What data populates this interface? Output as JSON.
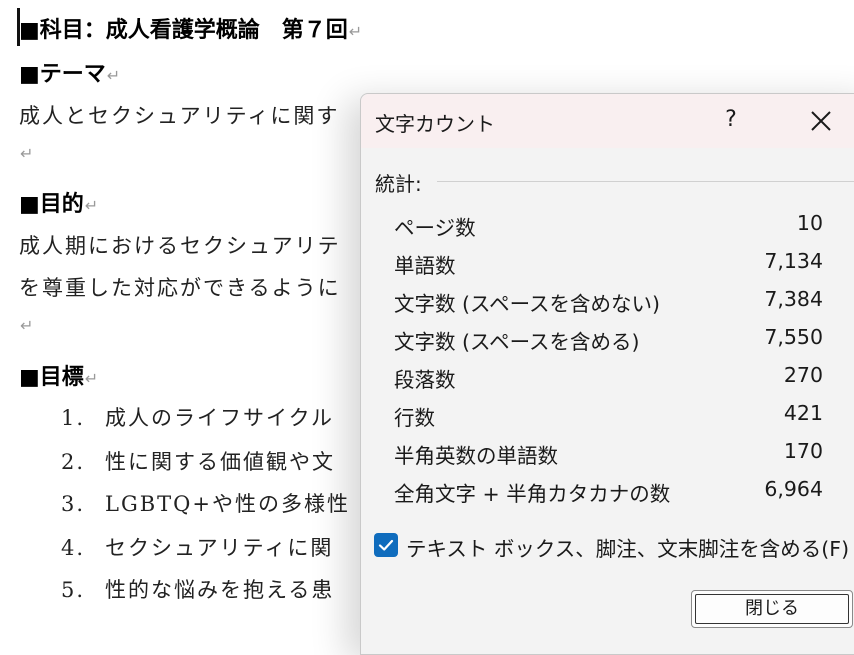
{
  "document": {
    "subject_title": "■科目：成人看護学概論　第７回",
    "theme_heading": "■テーマ",
    "theme_text": "成人とセクシュアリティに関す",
    "purpose_heading": "■目的",
    "purpose_line1": "成人期におけるセクシュアリテ",
    "purpose_line2": "を尊重した対応ができるように",
    "goals_heading": "■目標",
    "paragraph_mark": "↵",
    "goals": [
      {
        "num": "1.",
        "text": "成人のライフサイクル"
      },
      {
        "num": "2.",
        "text": "性に関する価値観や文"
      },
      {
        "num": "3.",
        "text": "LGBTQ+や性の多様性"
      },
      {
        "num": "4.",
        "text": "セクシュアリティに関"
      },
      {
        "num": "5.",
        "text": "性的な悩みを抱える患"
      }
    ]
  },
  "dialog": {
    "title": "文字カウント",
    "help_label": "?",
    "section_label": "統計:",
    "stats": [
      {
        "label": "ページ数",
        "value": "10"
      },
      {
        "label": "単語数",
        "value": "7,134"
      },
      {
        "label": "文字数 (スペースを含めない)",
        "value": "7,384"
      },
      {
        "label": "文字数 (スペースを含める)",
        "value": "7,550"
      },
      {
        "label": "段落数",
        "value": "270"
      },
      {
        "label": "行数",
        "value": "421"
      },
      {
        "label": "半角英数の単語数",
        "value": "170"
      },
      {
        "label": "全角文字 + 半角カタカナの数",
        "value": "6,964"
      }
    ],
    "checkbox_label": "テキスト ボックス、脚注、文末脚注を含める(F)",
    "checkbox_checked": true,
    "close_button_label": "閉じる"
  },
  "colors": {
    "accent": "#0f6cbd",
    "titlebar": "#f9eff0",
    "dialog_bg": "#f3f3f3"
  }
}
